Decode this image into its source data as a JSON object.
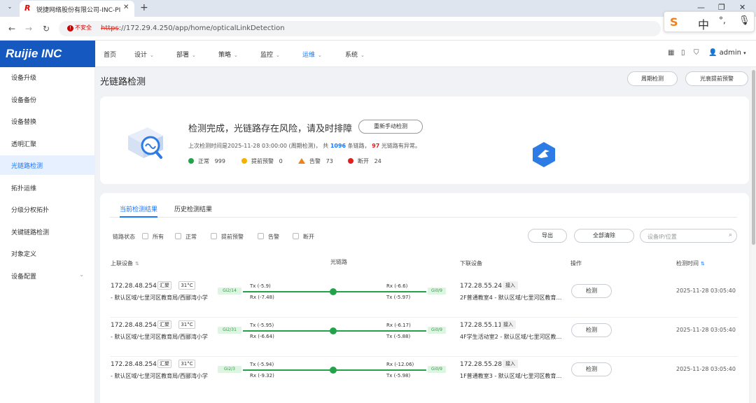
{
  "browser": {
    "tab_title": "锐捷网络股份有限公司-INC-PI",
    "url_proto": "https",
    "url_rest": "://172.29.4.250/app/home/opticalLinkDetection",
    "security_warning": "不安全",
    "ime": {
      "chinese": "中",
      "punct": "°,"
    }
  },
  "brand": {
    "name": "Ruijie INC"
  },
  "topnav": [
    {
      "label": "首页",
      "active": false,
      "dropdown": false
    },
    {
      "label": "设计",
      "active": false,
      "dropdown": true
    },
    {
      "label": "部署",
      "active": false,
      "dropdown": true
    },
    {
      "label": "策略",
      "active": false,
      "dropdown": true
    },
    {
      "label": "监控",
      "active": false,
      "dropdown": true
    },
    {
      "label": "运维",
      "active": true,
      "dropdown": true
    },
    {
      "label": "系统",
      "active": false,
      "dropdown": true
    }
  ],
  "user": {
    "name": "admin"
  },
  "sidebar": [
    {
      "label": "设备升级"
    },
    {
      "label": "设备备份"
    },
    {
      "label": "设备替换"
    },
    {
      "label": "透明汇聚"
    },
    {
      "label": "光链路检测",
      "active": true
    },
    {
      "label": "拓扑运维"
    },
    {
      "label": "分级分权拓扑"
    },
    {
      "label": "关键链路检测"
    },
    {
      "label": "对象定义"
    },
    {
      "label": "设备配置",
      "expandable": true
    }
  ],
  "page": {
    "title": "光链路检测",
    "periodic_btn": "周期检测",
    "warning_btn": "光衰提前预警"
  },
  "summary": {
    "headline": "检测完成，光链路存在风险，请及时排障",
    "recheck_btn": "重新手动检测",
    "last_check_prefix": "上次检测时间是2025-11-28 03:00:00 (周期检测)， 共",
    "total_links": "1096",
    "mid_text": "条链路，",
    "abnormal": "97",
    "suffix": "光链路有异常。",
    "stats": [
      {
        "label": "正常",
        "value": "999",
        "color": "#22a34a"
      },
      {
        "label": "提前预警",
        "value": "0",
        "color": "#f5b000"
      },
      {
        "label": "告警",
        "value": "73",
        "color": "#f07f1c"
      },
      {
        "label": "断开",
        "value": "24",
        "color": "#e02020"
      }
    ]
  },
  "tabs": {
    "current": "当前检测结果",
    "history": "历史检测结果"
  },
  "filters": {
    "label": "链路状态",
    "options": [
      "所有",
      "正常",
      "提前预警",
      "告警",
      "断开"
    ]
  },
  "actions": {
    "export": "导出",
    "clear": "全部清除",
    "search_placeholder": "设备IP/位置"
  },
  "columns": {
    "up": "上联设备",
    "link": "光链路",
    "down": "下联设备",
    "op": "操作",
    "time": "检测时间"
  },
  "rows": [
    {
      "up_ip": "172.28.48.254",
      "up_role": "汇聚",
      "temp": "31°C",
      "up_path": "- 默认区域/七里河区教育局/西郦湾小学",
      "port_l": "Gi2/14",
      "tx_l": "Tx (-5.9)",
      "rx_l": "Rx (-7.48)",
      "rx_r": "Rx (-6.6)",
      "tx_r": "Tx (-5.97)",
      "port_r": "Gi0/9",
      "down_ip": "172.28.55.24",
      "down_role": "接入",
      "down_path": "2F普通教室4 - 默认区域/七里河区教育局/西郦湾小学",
      "check": "检测",
      "time": "2025-11-28 03:05:40"
    },
    {
      "up_ip": "172.28.48.254",
      "up_role": "汇聚",
      "temp": "31°C",
      "up_path": "- 默认区域/七里河区教育局/西郦湾小学",
      "port_l": "Gi2/31",
      "tx_l": "Tx (-5.95)",
      "rx_l": "Rx (-6.64)",
      "rx_r": "Rx (-6.17)",
      "tx_r": "Tx (-5.88)",
      "port_r": "Gi0/9",
      "down_ip": "172.28.55.11",
      "down_role": "接入",
      "down_path": "4F学生活动室2 - 默认区域/七里河区教育局/西郦湾小学",
      "check": "检测",
      "time": "2025-11-28 03:05:40"
    },
    {
      "up_ip": "172.28.48.254",
      "up_role": "汇聚",
      "temp": "31°C",
      "up_path": "- 默认区域/七里河区教育局/西郦湾小学",
      "port_l": "Gi2/3",
      "tx_l": "Tx (-5.94)",
      "rx_l": "Rx (-9.32)",
      "rx_r": "Rx (-12.06)",
      "tx_r": "Tx (-5.98)",
      "port_r": "Gi0/9",
      "down_ip": "172.28.55.28",
      "down_role": "接入",
      "down_path": "1F普通教室3 - 默认区域/七里河区教育局/西郦湾小学",
      "check": "检测",
      "time": "2025-11-28 03:05:40"
    }
  ]
}
